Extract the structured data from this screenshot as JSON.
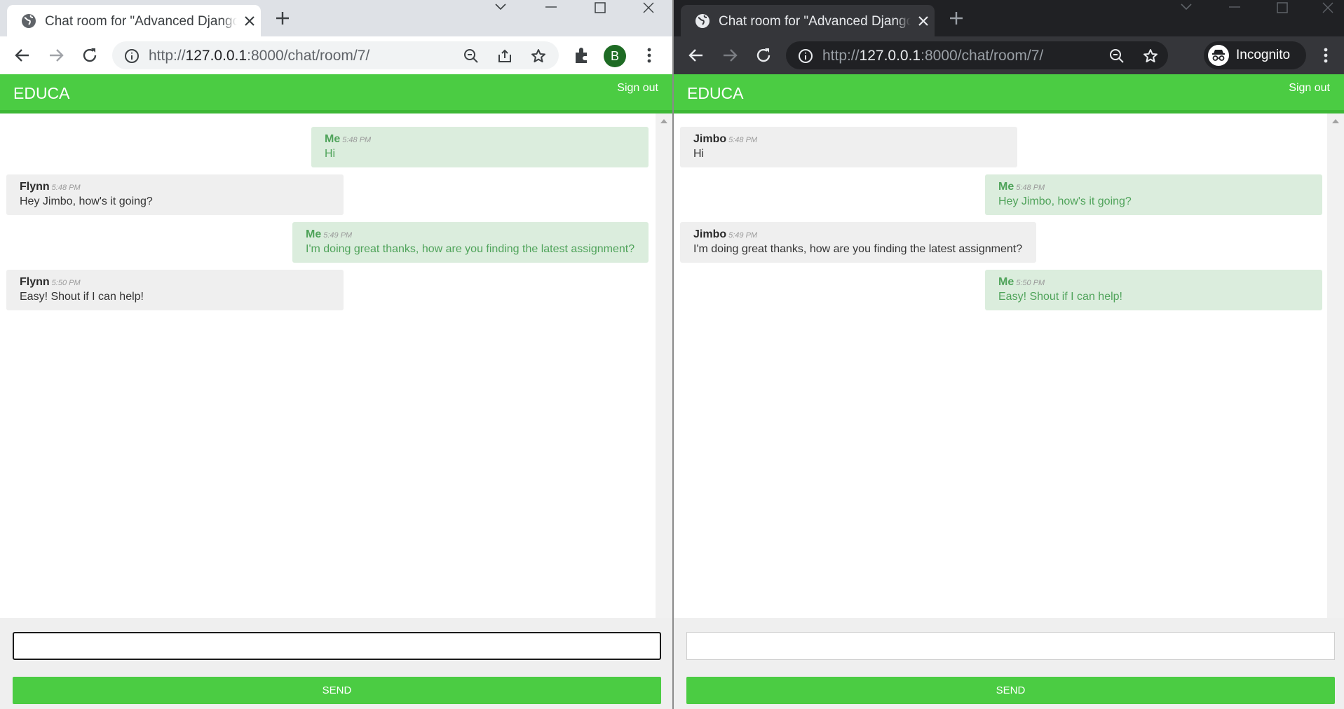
{
  "browser_left": {
    "tab_title": "Chat room for \"Advanced Django",
    "url_scheme": "http://",
    "url_host": "127.0.0.1",
    "url_path": ":8000/chat/room/7/",
    "profile_initial": "B"
  },
  "browser_right": {
    "tab_title": "Chat room for \"Advanced Django",
    "url_scheme": "http://",
    "url_host": "127.0.0.1",
    "url_path": ":8000/chat/room/7/",
    "incognito_label": "Incognito"
  },
  "site": {
    "logo": "EDUCA",
    "sign_out": "Sign out",
    "send_label": "SEND",
    "accent_color": "#4bcc43"
  },
  "chat_left": {
    "messages": [
      {
        "author": "Me",
        "time": "5:48 PM",
        "text": "Hi"
      },
      {
        "author": "Flynn",
        "time": "5:48 PM",
        "text": "Hey Jimbo, how's it going?"
      },
      {
        "author": "Me",
        "time": "5:49 PM",
        "text": "I'm doing great thanks, how are you finding the latest assignment?"
      },
      {
        "author": "Flynn",
        "time": "5:50 PM",
        "text": "Easy! Shout if I can help!"
      }
    ]
  },
  "chat_right": {
    "messages": [
      {
        "author": "Jimbo",
        "time": "5:48 PM",
        "text": "Hi"
      },
      {
        "author": "Me",
        "time": "5:48 PM",
        "text": "Hey Jimbo, how's it going?"
      },
      {
        "author": "Jimbo",
        "time": "5:49 PM",
        "text": "I'm doing great thanks, how are you finding the latest assignment?"
      },
      {
        "author": "Me",
        "time": "5:50 PM",
        "text": "Easy! Shout if I can help!"
      }
    ]
  }
}
